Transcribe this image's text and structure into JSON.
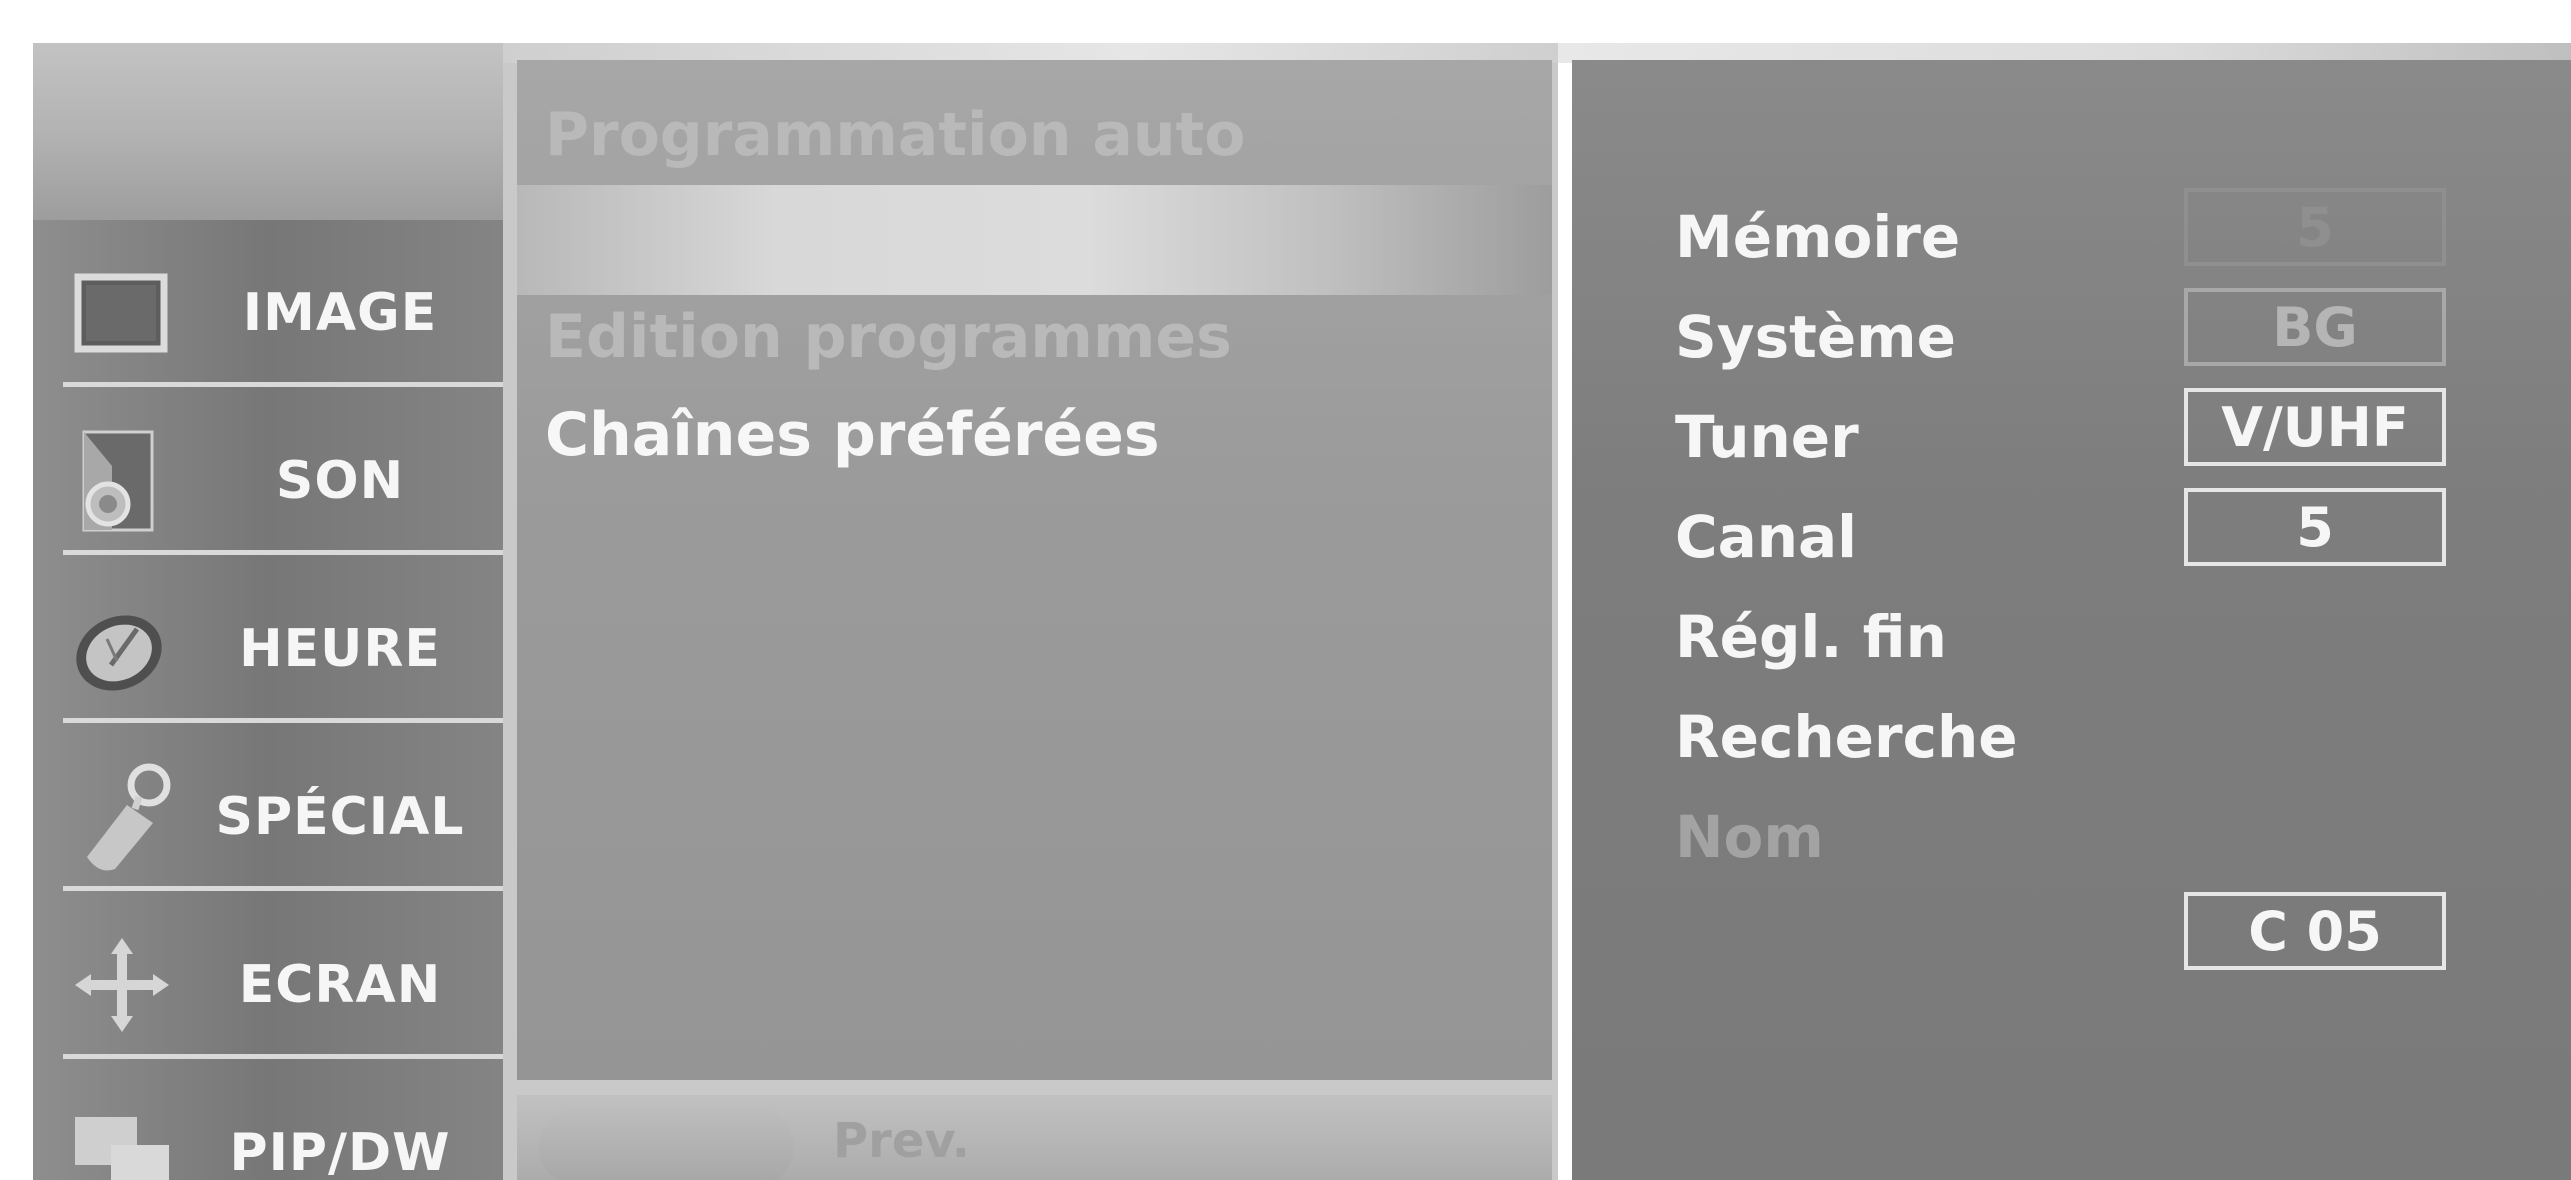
{
  "sidebar": {
    "items": [
      {
        "label": "IMAGE",
        "icon": "monitor-icon"
      },
      {
        "label": "SON",
        "icon": "speaker-icon"
      },
      {
        "label": "HEURE",
        "icon": "clock-icon"
      },
      {
        "label": "SPÉCIAL",
        "icon": "key-tag-icon"
      },
      {
        "label": "ECRAN",
        "icon": "move-arrows-icon"
      },
      {
        "label": "PIP/DW",
        "icon": "pip-windows-icon"
      }
    ]
  },
  "menu": {
    "items": [
      {
        "label": "Programmation auto",
        "state": "dim"
      },
      {
        "label": "",
        "state": "highlighted"
      },
      {
        "label": "Edition programmes",
        "state": "dim"
      },
      {
        "label": "Chaînes préférées",
        "state": "bright"
      }
    ],
    "prev_label": "Prev."
  },
  "settings": {
    "rows": [
      {
        "label": "Mémoire",
        "value": "5",
        "enabled": true
      },
      {
        "label": "Système",
        "value": "BG",
        "enabled": true
      },
      {
        "label": "Tuner",
        "value": "V/UHF",
        "enabled": true
      },
      {
        "label": "Canal",
        "value": "5",
        "enabled": true
      },
      {
        "label": "Régl. fin",
        "value": null,
        "enabled": true
      },
      {
        "label": "Recherche",
        "value": null,
        "enabled": true
      },
      {
        "label": "Nom",
        "value": null,
        "enabled": false
      }
    ],
    "name_value": "C 05"
  }
}
